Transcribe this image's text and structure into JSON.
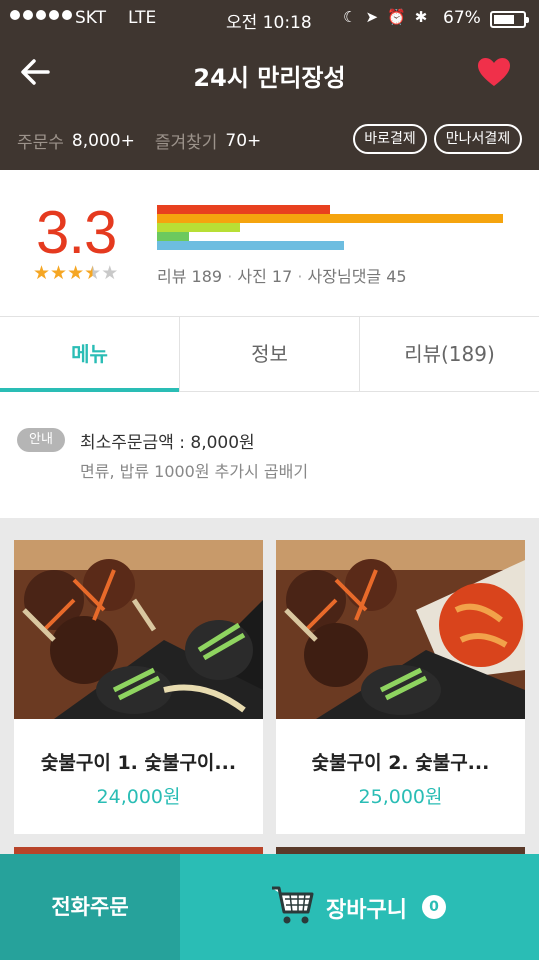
{
  "status_bar": {
    "carrier": "SKT",
    "network": "LTE",
    "time": "오전 10:18",
    "battery": "67%"
  },
  "header": {
    "title": "24시 만리장성",
    "orders_label": "주문수",
    "orders_value": "8,000+",
    "favorites_label": "즐겨찾기",
    "favorites_value": "70+",
    "direct_pay": "바로결제",
    "meet_pay": "만나서결제",
    "colors": {
      "background": "#3f3630",
      "heart": "#f0304a"
    }
  },
  "rating": {
    "score": "3.3",
    "stars_value": 3.5,
    "stars_max": 5,
    "review_label": "리뷰",
    "review_count": "189",
    "photo_label": "사진",
    "photo_count": "17",
    "reply_label": "사장님댓글",
    "reply_count": "45",
    "distribution_bars": [
      {
        "color": "#e8401f",
        "fraction": 0.48
      },
      {
        "color": "#f5a40e",
        "fraction": 0.96
      },
      {
        "color": "#b8df35",
        "fraction": 0.23
      },
      {
        "color": "#6cc95e",
        "fraction": 0.09
      },
      {
        "color": "#6dbde0",
        "fraction": 0.52
      }
    ]
  },
  "tabs": [
    {
      "label": "메뉴",
      "active": true
    },
    {
      "label": "정보",
      "active": false
    },
    {
      "label": "리뷰(189)",
      "active": false
    }
  ],
  "notice": {
    "badge": "안내",
    "line1": "최소주문금액 : 8,000원",
    "line2": "면류, 밥류 1000원 추가시 곱배기"
  },
  "menu": [
    {
      "name": "숯불구이 1. 숯불구이...",
      "price": "24,000원"
    },
    {
      "name": "숯불구이 2. 숯불구...",
      "price": "25,000원"
    }
  ],
  "bottom_bar": {
    "call_order": "전화주문",
    "cart": "장바구니",
    "cart_count": "0",
    "colors": {
      "call": "#26a29b",
      "cart": "#2abdb5"
    }
  }
}
